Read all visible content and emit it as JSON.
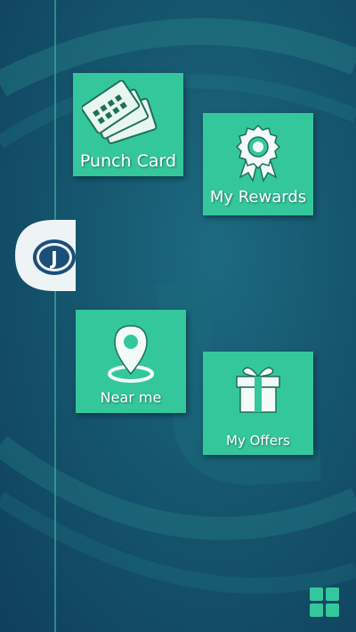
{
  "tiles": {
    "punch_card": {
      "label": "Punch Card",
      "icon": "punch-cards-icon"
    },
    "my_rewards": {
      "label": "My Rewards",
      "icon": "award-ribbon-icon"
    },
    "near_me": {
      "label": "Near me",
      "icon": "location-pin-icon"
    },
    "my_offers": {
      "label": "My Offers",
      "icon": "gift-box-icon"
    }
  },
  "drawer": {
    "logo_letter": "J",
    "icon": "app-logo-tab"
  },
  "menu": {
    "icon": "grid-menu-icon"
  },
  "colors": {
    "tile": "#35c79c",
    "background_dark": "#0f3f5c",
    "background_light": "#1d6a80",
    "logo_blue": "#1a4f7a"
  }
}
